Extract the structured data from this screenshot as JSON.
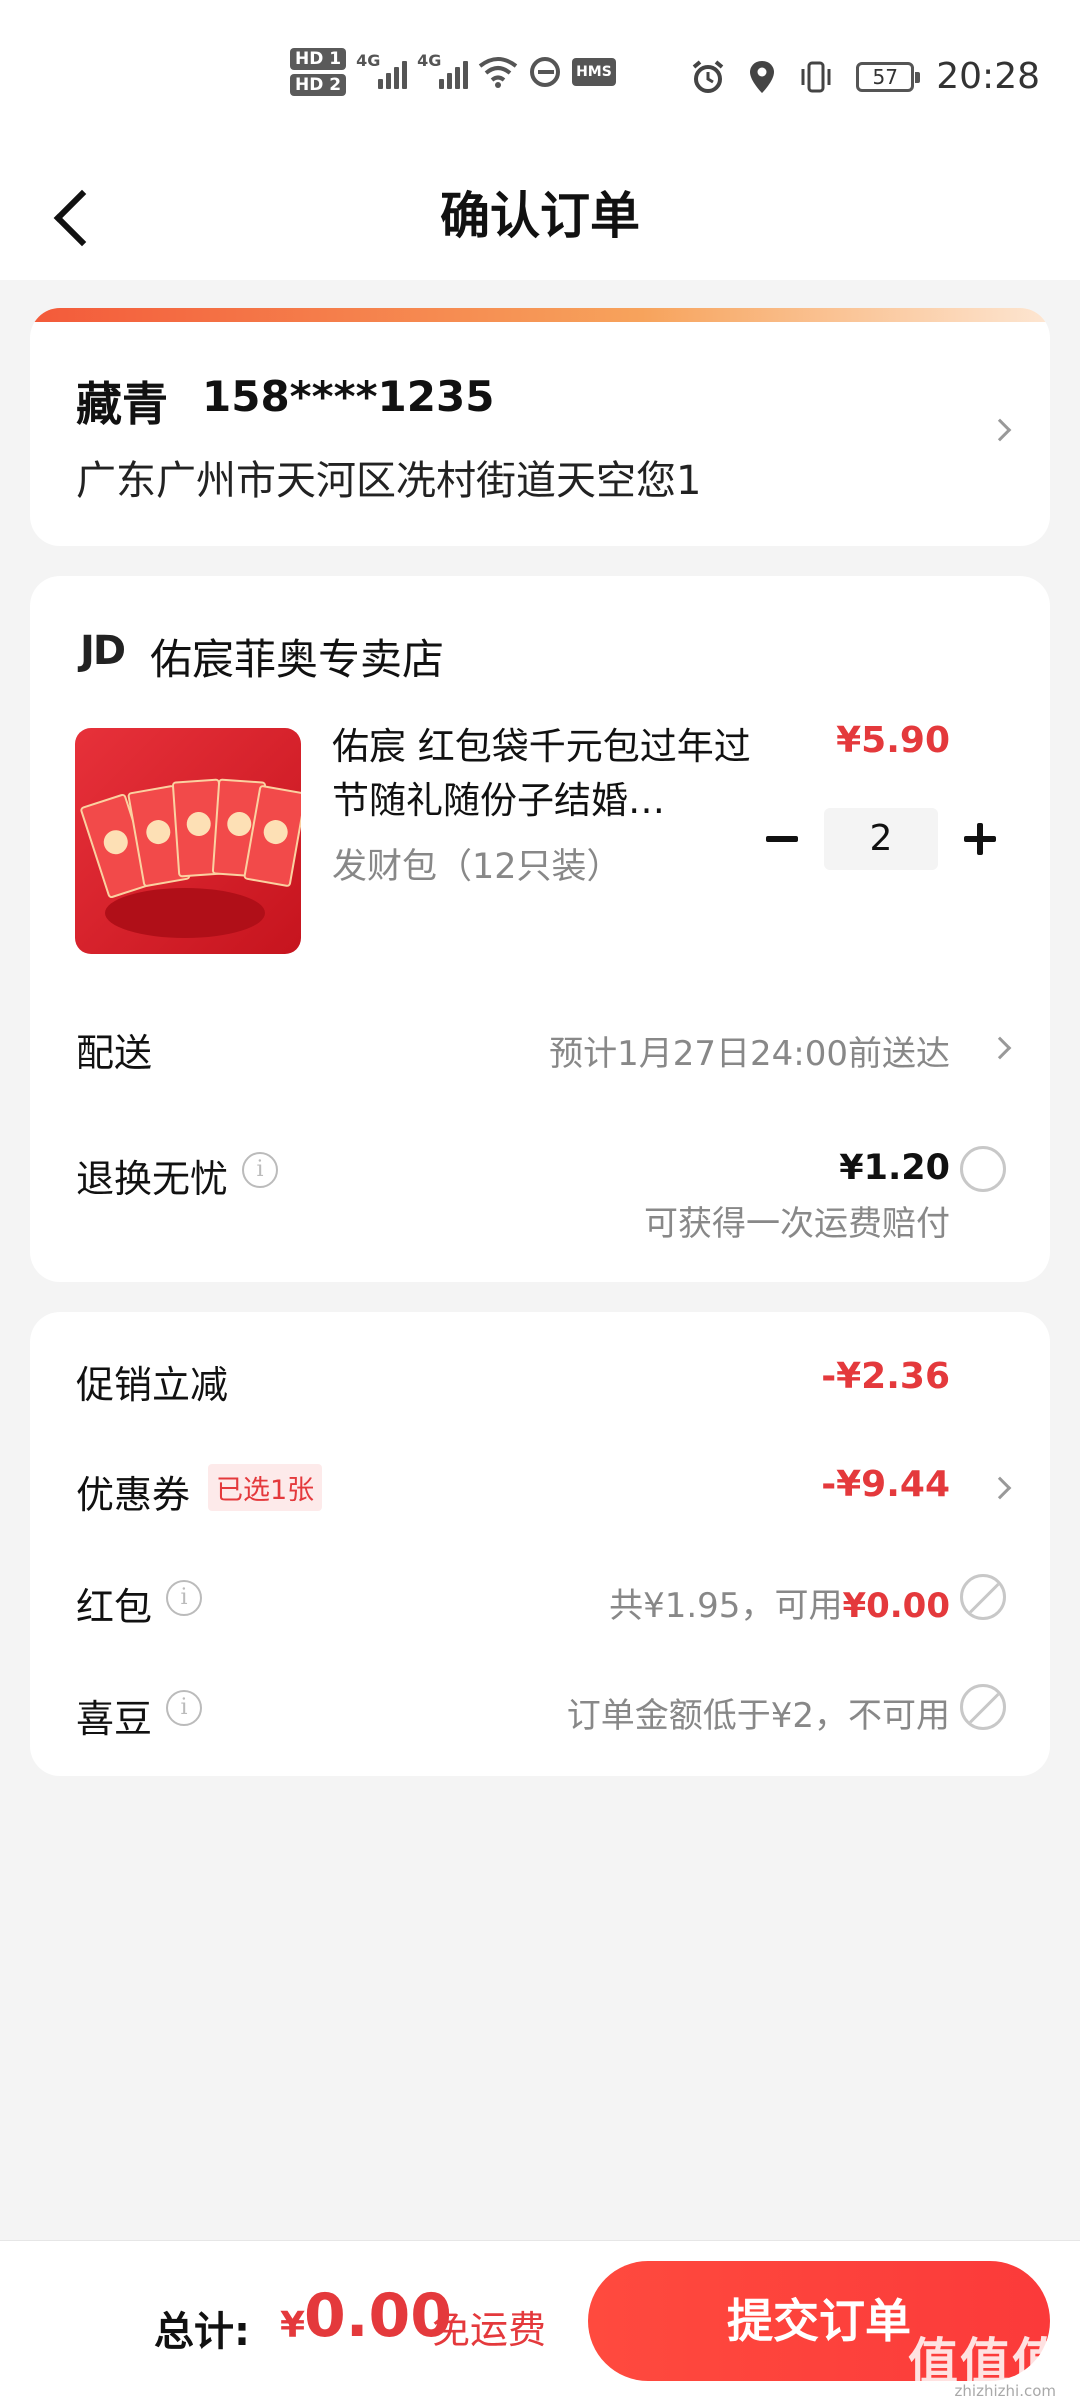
{
  "status_bar": {
    "hd1": "HD 1",
    "hd2": "HD 2",
    "net1": "4G",
    "net2": "4G",
    "hms": "HMS",
    "battery": "57",
    "time": "20:28"
  },
  "header": {
    "title": "确认订单"
  },
  "address": {
    "name": "藏青",
    "phone": "158****1235",
    "line": "广东广州市天河区冼村街道天空您1"
  },
  "shop": {
    "logo": "JD",
    "name": "佑宸菲奥专卖店"
  },
  "product": {
    "title": "佑宸 红包袋千元包过年过节随礼随份子结婚…",
    "spec": "发财包（12只装）",
    "price": "¥5.90",
    "quantity": "2"
  },
  "delivery": {
    "label": "配送",
    "value": "预计1月27日24:00前送达"
  },
  "return_insurance": {
    "label": "退换无忧",
    "price": "¥1.20",
    "note": "可获得一次运费赔付"
  },
  "discounts": {
    "promo_label": "促销立减",
    "promo_value": "-¥2.36",
    "coupon_label": "优惠券",
    "coupon_badge": "已选1张",
    "coupon_value": "-¥9.44",
    "redpacket_label": "红包",
    "redpacket_prefix": "共¥1.95，可用",
    "redpacket_value": "¥0.00",
    "xidou_label": "喜豆",
    "xidou_value": "订单金额低于¥2，不可用"
  },
  "footer": {
    "total_label": "总计:",
    "total_symbol": "¥",
    "total_value": "0.00",
    "free_shipping": "免运费",
    "submit": "提交订单"
  },
  "watermark": {
    "text": "值值值",
    "sub": "zhizhizhi.com"
  }
}
